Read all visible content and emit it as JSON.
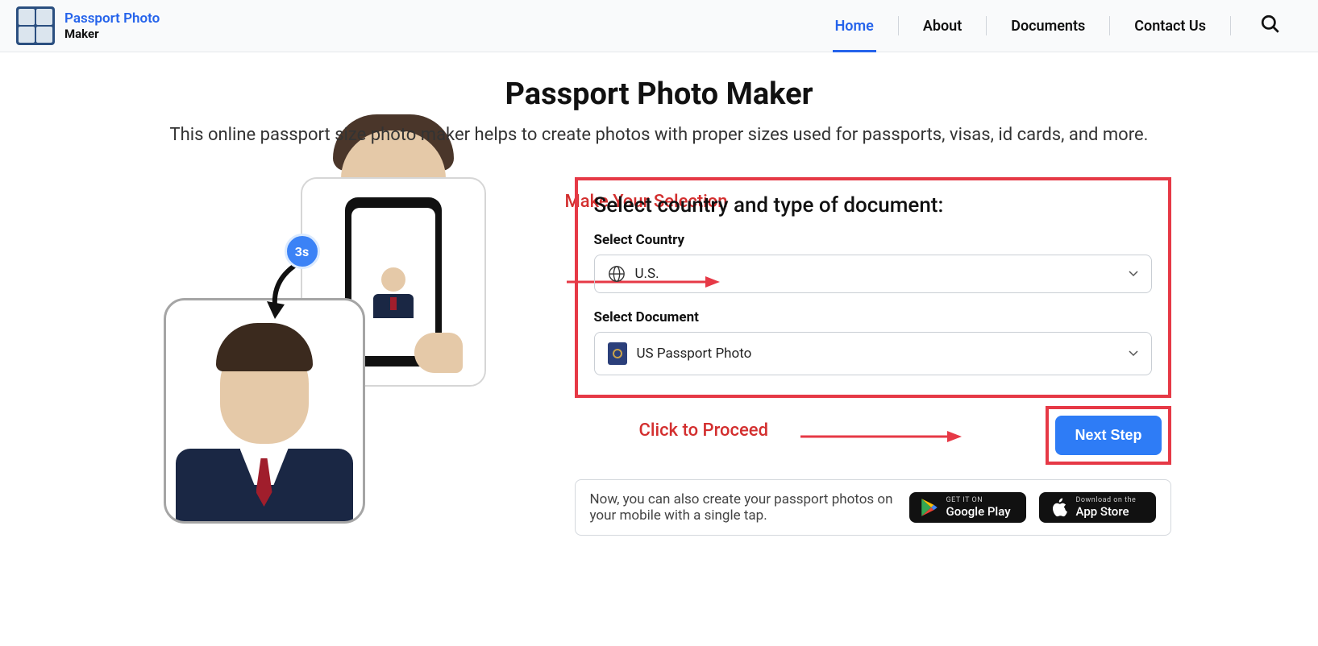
{
  "brand": {
    "title": "Passport Photo",
    "sub": "Maker"
  },
  "nav": {
    "home": "Home",
    "about": "About",
    "documents": "Documents",
    "contact": "Contact Us"
  },
  "page": {
    "title": "Passport Photo Maker",
    "desc": "This online passport size photo maker helps to create photos with proper sizes used for passports, visas, id cards, and more."
  },
  "badge": "3s",
  "annotations": {
    "selection": "Make Your Selection",
    "proceed": "Click to Proceed"
  },
  "form": {
    "heading": "Select country and type of document:",
    "country_label": "Select Country",
    "country_value": "U.S.",
    "document_label": "Select Document",
    "document_value": "US Passport Photo",
    "next": "Next Step"
  },
  "apps": {
    "text": "Now, you can also create your passport photos on your mobile with a single tap.",
    "google_small": "GET IT ON",
    "google_big": "Google Play",
    "apple_small": "Download on the",
    "apple_big": "App Store"
  }
}
